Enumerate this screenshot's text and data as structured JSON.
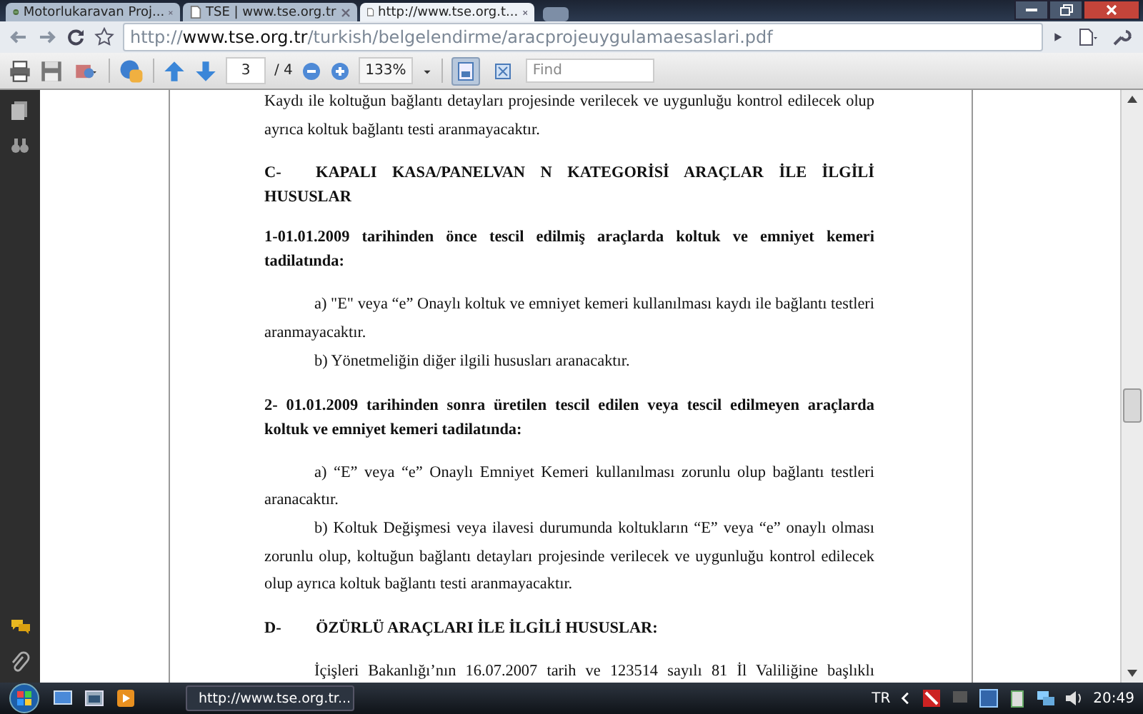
{
  "tabs": [
    {
      "label": "Motorlukaravan Proj...",
      "selected": false
    },
    {
      "label": "TSE | www.tse.org.tr",
      "selected": false
    },
    {
      "label": "http://www.tse.org.t...",
      "selected": true
    }
  ],
  "address_bar": {
    "scheme": "http://",
    "host": "www.tse.org.tr",
    "path": "/turkish/belgelendirme/aracprojeuygulamaesaslari.pdf"
  },
  "pdf_toolbar": {
    "page": "3",
    "page_count": "/ 4",
    "zoom": "133%",
    "find_placeholder": "Find",
    "views": [
      {
        "kind": "single",
        "selected": true
      },
      {
        "kind": "fit",
        "selected": false
      }
    ]
  },
  "document": {
    "blocks": [
      {
        "kind": "body",
        "indent": false,
        "continues": false,
        "text": "Kaydı ile koltuğun bağlantı detayları projesinde verilecek ve uygunluğu kontrol edilecek olup ayrıca koltuk bağlantı testi aranmayacaktır."
      },
      {
        "kind": "heading",
        "label": "C-",
        "text": "KAPALI KASA/PANELVAN N KATEGORİSİ ARAÇLAR İLE İLGİLİ HUSUSLAR"
      },
      {
        "kind": "bold",
        "text": "1-01.01.2009 tarihinden önce tescil edilmiş araçlarda koltuk ve emniyet kemeri tadilatında:"
      },
      {
        "kind": "body",
        "indent": true,
        "continues": false,
        "text": "a) \"E\" veya “e” Onaylı koltuk ve emniyet kemeri kullanılması kaydı ile bağlantı testleri aranmayacaktır."
      },
      {
        "kind": "body",
        "indent": true,
        "continues": false,
        "text": "b) Yönetmeliğin diğer ilgili hususları aranacaktır."
      },
      {
        "kind": "bold",
        "text": "2- 01.01.2009 tarihinden sonra üretilen tescil edilen veya tescil edilmeyen araçlarda koltuk ve emniyet kemeri tadilatında:"
      },
      {
        "kind": "body",
        "indent": true,
        "continues": false,
        "text": "a) “E” veya “e” Onaylı Emniyet Kemeri kullanılması zorunlu olup bağlantı testleri aranacaktır."
      },
      {
        "kind": "body",
        "indent": true,
        "continues": false,
        "text": "b) Koltuk Değişmesi veya ilavesi durumunda koltukların “E” veya “e” onaylı olması zorunlu olup, koltuğun bağlantı detayları projesinde verilecek ve uygunluğu kontrol edilecek olup ayrıca koltuk bağlantı testi aranmayacaktır."
      },
      {
        "kind": "heading",
        "label": "D-",
        "text": "ÖZÜRLÜ ARAÇLARI İLE İLGİLİ HUSUSLAR:"
      },
      {
        "kind": "body",
        "indent": true,
        "continues": true,
        "text": "İçişleri Bakanlığı’nın 16.07.2007 tarih ve 123514 sayılı 81 İl Valiliğine başlıklı"
      }
    ]
  },
  "taskbar": {
    "task": "http://www.tse.org.tr...",
    "language": "TR",
    "clock": "20:49"
  }
}
